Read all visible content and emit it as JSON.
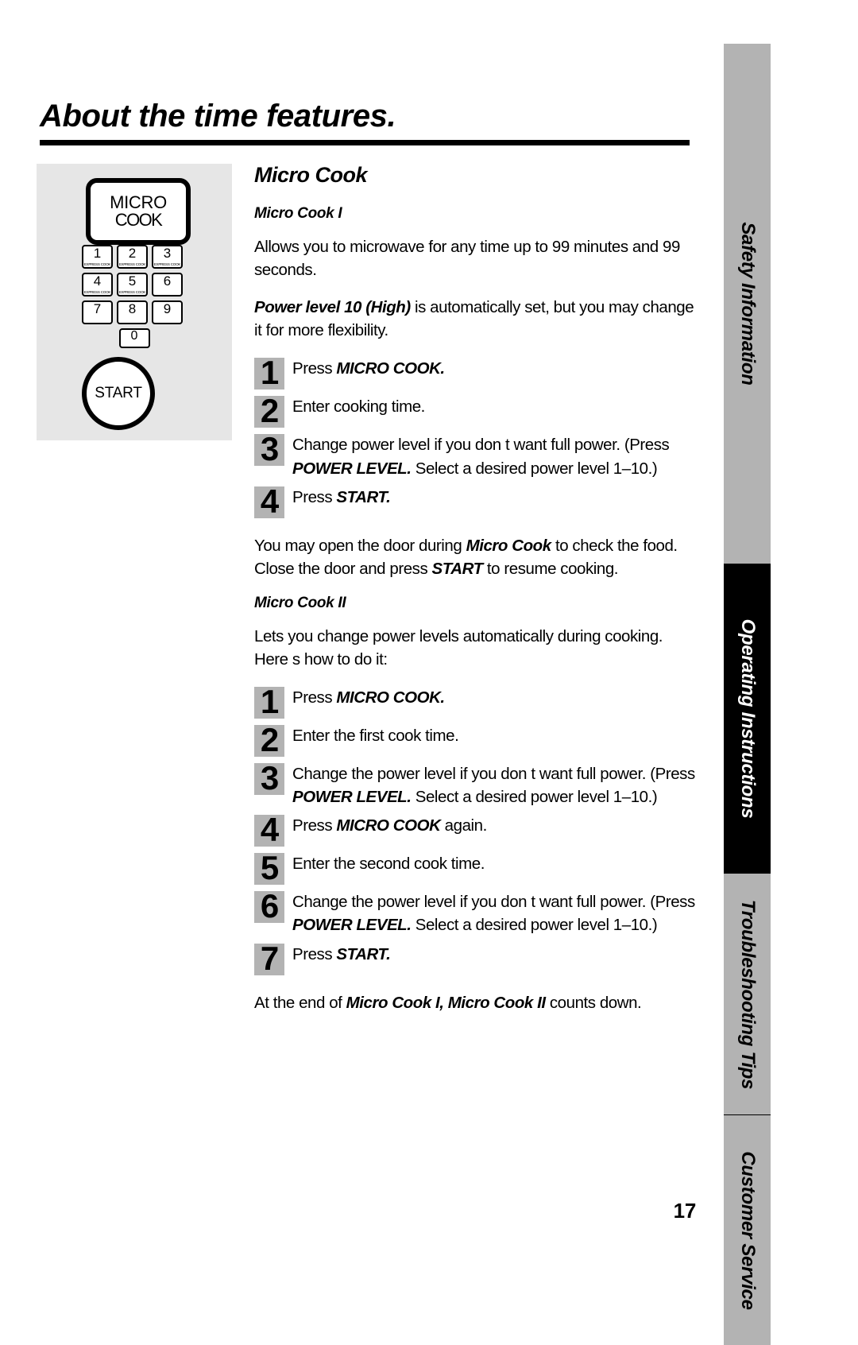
{
  "page": {
    "title": "About the time features.",
    "number": "17"
  },
  "figure": {
    "micro_cook_key": {
      "line1": "MICRO",
      "line2": "COOK"
    },
    "keypad": {
      "keys": [
        {
          "digit": "1",
          "sublabel": "EXPRESS COOK"
        },
        {
          "digit": "2",
          "sublabel": "EXPRESS COOK"
        },
        {
          "digit": "3",
          "sublabel": "EXPRESS COOK"
        },
        {
          "digit": "4",
          "sublabel": "EXPRESS COOK"
        },
        {
          "digit": "5",
          "sublabel": "EXPRESS COOK"
        },
        {
          "digit": "6",
          "sublabel": ""
        },
        {
          "digit": "7",
          "sublabel": ""
        },
        {
          "digit": "8",
          "sublabel": ""
        },
        {
          "digit": "9",
          "sublabel": ""
        },
        {
          "digit": "0",
          "sublabel": ""
        }
      ]
    },
    "start_key": "START"
  },
  "content": {
    "section_title": "Micro Cook",
    "micro_cook_1": {
      "heading": "Micro Cook I",
      "para_1": "Allows you to microwave for any time up to 99 minutes and 99 seconds.",
      "para_2_italic": "Power level 10 (High)",
      "para_2_rest": " is automatically set, but you may change it for more flexibility.",
      "steps": [
        {
          "num": "1",
          "text_before": "Press ",
          "text_italic": "MICRO COOK.",
          "text_after": ""
        },
        {
          "num": "2",
          "text_before": "Enter cooking time.",
          "text_italic": "",
          "text_after": ""
        },
        {
          "num": "3",
          "text_before": "Change power level if you don t want full power. (Press ",
          "text_italic": "POWER LEVEL.",
          "text_after": " Select a desired power level 1–10.)"
        },
        {
          "num": "4",
          "text_before": "Press ",
          "text_italic": "START.",
          "text_after": ""
        }
      ],
      "closing_para_1": "You may open the door during ",
      "closing_italic_1": "Micro Cook",
      "closing_para_2": " to check the food. Close the door and press ",
      "closing_italic_2": "START",
      "closing_para_3": " to resume cooking."
    },
    "micro_cook_2": {
      "heading": "Micro Cook II",
      "para_1": "Lets you change power levels automatically during cooking. Here s how to do it:",
      "steps": [
        {
          "num": "1",
          "text_before": "Press ",
          "text_italic": "MICRO COOK.",
          "text_after": ""
        },
        {
          "num": "2",
          "text_before": "Enter the first cook time.",
          "text_italic": "",
          "text_after": ""
        },
        {
          "num": "3",
          "text_before": "Change the power level if you don t want full power. (Press ",
          "text_italic": "POWER LEVEL.",
          "text_after": " Select a desired power level 1–10.)"
        },
        {
          "num": "4",
          "text_before": "Press ",
          "text_italic": "MICRO COOK",
          "text_after": " again."
        },
        {
          "num": "5",
          "text_before": "Enter the second cook time.",
          "text_italic": "",
          "text_after": ""
        },
        {
          "num": "6",
          "text_before": "Change the power level if you don t want full power. (Press ",
          "text_italic": "POWER LEVEL.",
          "text_after": " Select a desired power level 1–10.)"
        },
        {
          "num": "7",
          "text_before": "Press ",
          "text_italic": "START.",
          "text_after": ""
        }
      ],
      "closing_para_1": "At the end of ",
      "closing_italic_1": "Micro Cook I, Micro Cook II",
      "closing_para_2": " counts down."
    }
  },
  "side_tabs": [
    {
      "label": "Safety Information",
      "active": false
    },
    {
      "label": "Operating Instructions",
      "active": true
    },
    {
      "label": "Troubleshooting Tips",
      "active": false
    },
    {
      "label": "Customer Service",
      "active": false
    }
  ]
}
